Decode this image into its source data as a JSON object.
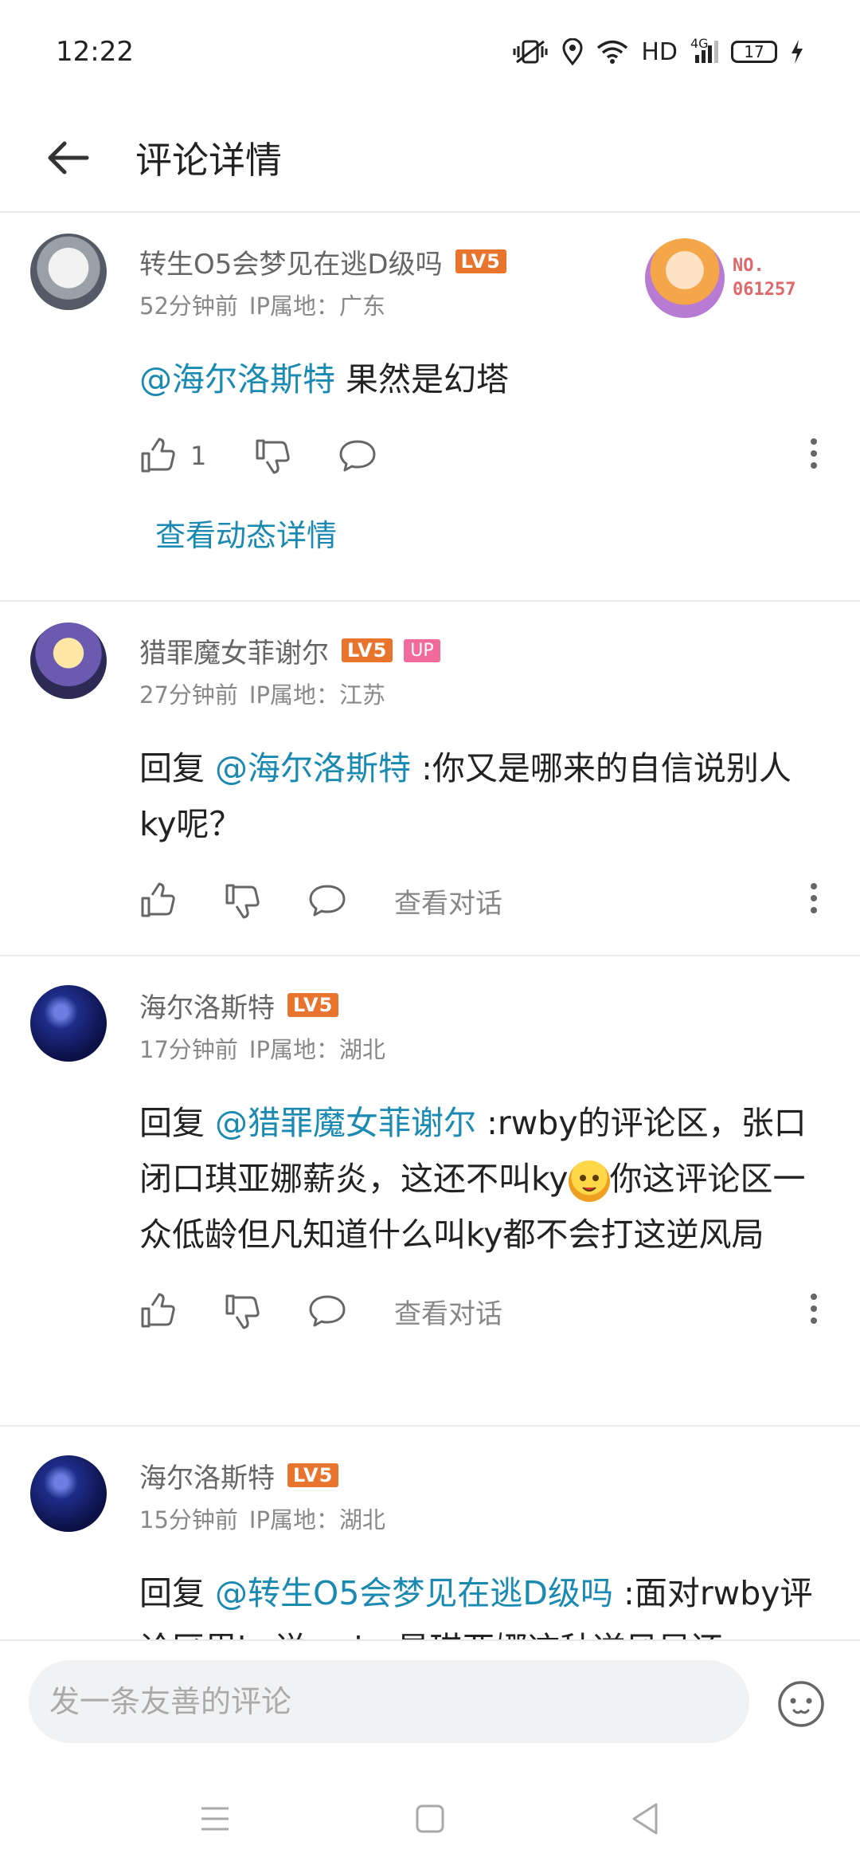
{
  "status_bar": {
    "time": "12:22",
    "network": "HD",
    "signal_type": "4G",
    "battery": "17"
  },
  "header": {
    "title": "评论详情"
  },
  "comments": [
    {
      "name": "转生O5会梦见在逃D级吗",
      "level": "LV5",
      "time": "52分钟前",
      "ip": "IP属地：广东",
      "mention": "@海尔洛斯特",
      "text": " 果然是幻塔",
      "likes": "1",
      "badge_no_label": "NO.",
      "badge_no_value": "061257",
      "detail_link": "查看动态详情"
    },
    {
      "name": "猎罪魔女菲谢尔",
      "level": "LV5",
      "up_badge": "UP",
      "time": "27分钟前",
      "ip": "IP属地：江苏",
      "reply_prefix": "回复 ",
      "mention": "@海尔洛斯特",
      "text": " :你又是哪来的自信说别人ky呢？",
      "view_conversation": "查看对话"
    },
    {
      "name": "海尔洛斯特",
      "level": "LV5",
      "time": "17分钟前",
      "ip": "IP属地：湖北",
      "reply_prefix": "回复 ",
      "mention": "@猎罪魔女菲谢尔",
      "text_a": " :rwby的评论区，张口闭口琪亚娜薪炎，这还不叫ky",
      "text_b": "你这评论区一众低龄但凡知道什么叫ky都不会打这逆风局",
      "view_conversation": "查看对话"
    },
    {
      "name": "海尔洛斯特",
      "level": "LV5",
      "time": "15分钟前",
      "ip": "IP属地：湖北",
      "reply_prefix": "回复 ",
      "mention": "@转生O5会梦见在逃D级吗",
      "text": " :面对rwby评论区里ky说weiss是琪亚娜这种逆风局还"
    }
  ],
  "input": {
    "placeholder": "发一条友善的评论"
  },
  "colors": {
    "mention": "#1a8ab3",
    "level_badge": "#e8742e",
    "up_badge": "#f36b9a"
  }
}
